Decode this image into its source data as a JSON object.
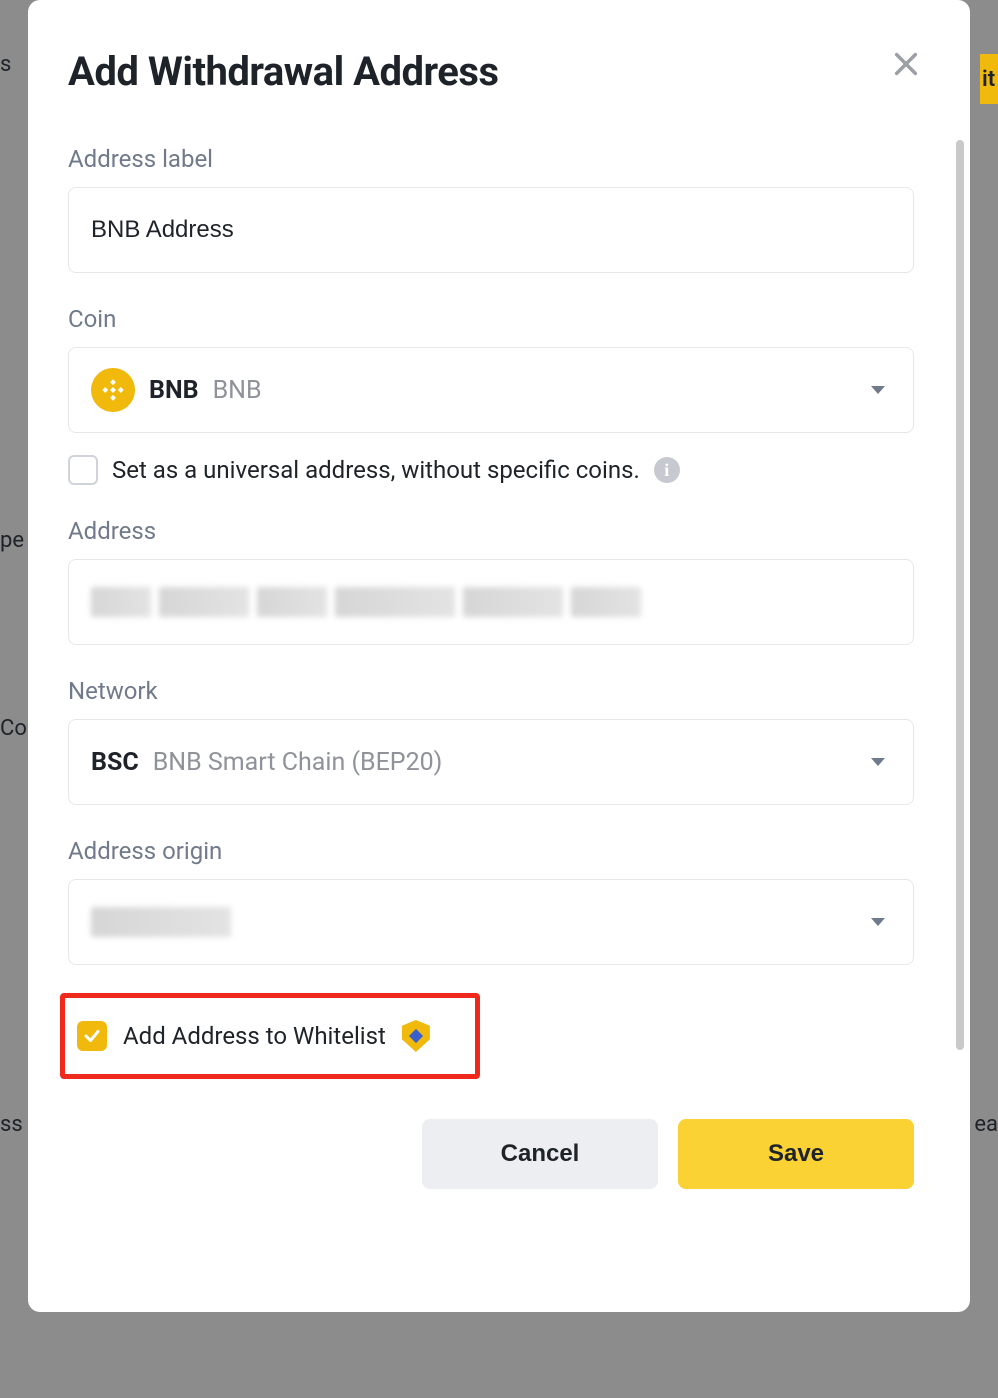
{
  "modal": {
    "title": "Add Withdrawal Address",
    "address_label": {
      "label": "Address label",
      "value": "BNB Address"
    },
    "coin": {
      "label": "Coin",
      "symbol": "BNB",
      "name": "BNB"
    },
    "universal": {
      "label": "Set as a universal address, without specific coins.",
      "checked": false
    },
    "address": {
      "label": "Address",
      "value": ""
    },
    "network": {
      "label": "Network",
      "symbol": "BSC",
      "name": "BNB Smart Chain (BEP20)"
    },
    "origin": {
      "label": "Address origin",
      "value": ""
    },
    "whitelist": {
      "label": "Add Address to Whitelist",
      "checked": true
    },
    "buttons": {
      "cancel": "Cancel",
      "save": "Save"
    }
  },
  "background": {
    "left1": "s",
    "left2": "pe",
    "left3": "Co",
    "left4": "ss",
    "right1": "it",
    "right2": "ea"
  }
}
